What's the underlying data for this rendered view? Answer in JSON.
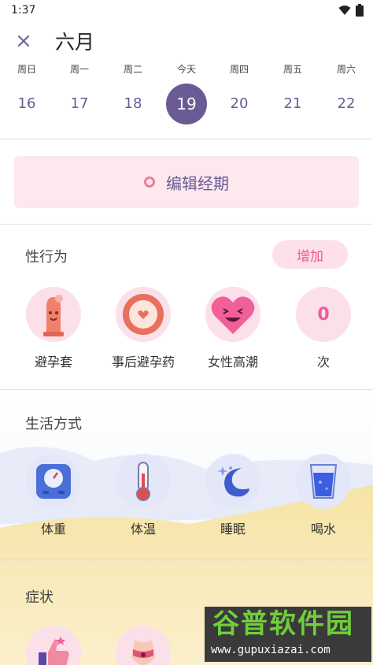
{
  "status": {
    "time": "1:37"
  },
  "header": {
    "title": "六月"
  },
  "week": [
    {
      "label": "周日",
      "num": "16",
      "today": false
    },
    {
      "label": "周一",
      "num": "17",
      "today": false
    },
    {
      "label": "周二",
      "num": "18",
      "today": false
    },
    {
      "label": "今天",
      "num": "19",
      "today": true
    },
    {
      "label": "周四",
      "num": "20",
      "today": false
    },
    {
      "label": "周五",
      "num": "21",
      "today": false
    },
    {
      "label": "周六",
      "num": "22",
      "today": false
    }
  ],
  "period": {
    "label": "编辑经期"
  },
  "sex": {
    "title": "性行为",
    "add_label": "增加",
    "items": [
      "避孕套",
      "事后避孕药",
      "女性高潮",
      "次"
    ],
    "count": "0"
  },
  "lifestyle": {
    "title": "生活方式",
    "items": [
      "体重",
      "体温",
      "睡眠",
      "喝水"
    ]
  },
  "symptoms": {
    "title": "症状"
  },
  "watermark": {
    "big": "谷普软件园",
    "small": "www.gupuxiazai.com"
  },
  "colors": {
    "accent": "#6b5b95",
    "pink": "#ee5a8a",
    "pink_bg": "#fde8ee"
  }
}
